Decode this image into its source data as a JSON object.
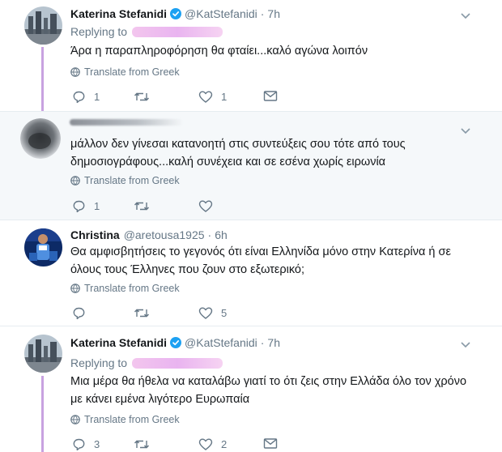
{
  "tweets": [
    {
      "name": "Katerina Stefanidi",
      "handle": "@KatStefanidi",
      "time": "7h",
      "replying_to": "Replying to",
      "text": "Άρα η παραπληροφόρηση θα φταίει...καλό αγώνα λοιπόν",
      "translate": "Translate from Greek",
      "replies": "1",
      "retweets": "",
      "likes": "1"
    },
    {
      "name": "",
      "handle": "",
      "time": "",
      "text_line1": "μάλλον δεν γίνεσαι κατανοητή στις συντεύξεις σου τότε από τους",
      "text_line2": "δημοσιογράφους...καλή συνέχεια και σε εσένα χωρίς ειρωνία",
      "translate": "Translate from Greek",
      "replies": "1",
      "retweets": "",
      "likes": ""
    },
    {
      "name": "Christina",
      "handle": "@aretousa1925",
      "time": "6h",
      "text_line1": "Θα αμφισβητήσεις το γεγονός ότι είναι Ελληνίδα μόνο στην Κατερίνα ή σε",
      "text_line2": "όλους τους Έλληνες που ζουν στο εξωτερικό;",
      "translate": "Translate from Greek",
      "replies": "",
      "retweets": "",
      "likes": "5"
    },
    {
      "name": "Katerina Stefanidi",
      "handle": "@KatStefanidi",
      "time": "7h",
      "replying_to": "Replying to",
      "text_line1": "Μια μέρα θα ήθελα να καταλάβω γιατί το ότι ζεις στην Ελλάδα όλο τον χρόνο",
      "text_line2": "με κάνει εμένα λιγότερο Ευρωπαία",
      "translate": "Translate from Greek",
      "replies": "3",
      "retweets": "",
      "likes": "2"
    }
  ],
  "colors": {
    "verified": "#1da1f2",
    "muted": "#657786",
    "thread_line": "#c8a2e0",
    "alt_background": "#f5f8fa"
  },
  "icons": [
    "chevron-down-icon",
    "verified-icon",
    "globe-icon",
    "reply-icon",
    "retweet-icon",
    "like-icon",
    "message-icon"
  ]
}
